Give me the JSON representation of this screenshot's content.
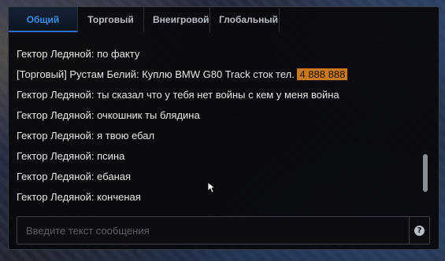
{
  "tabs": [
    {
      "label": "Общий",
      "active": true
    },
    {
      "label": "Торговый",
      "active": false
    },
    {
      "label": "Внеигровой",
      "active": false
    },
    {
      "label": "Глобальный",
      "active": false
    }
  ],
  "messages": [
    {
      "text": "Гектор Ледяной: по факту"
    },
    {
      "text": "[Торговый] Рустам Белий: Куплю BMW G80 Track сток тел.",
      "phone": "4 888 888",
      "phone_color": "#c9781d"
    },
    {
      "text": "Гектор Ледяной: ты сказал что у тебя нет войны с кем у меня война"
    },
    {
      "text": "Гектор Ледяной: очкошник ты блядина"
    },
    {
      "text": "Гектор Ледяной: я твою ебал"
    },
    {
      "text": "Гектор Ледяной: псина"
    },
    {
      "text": "Гектор Ледяной: ебаная"
    },
    {
      "text": "Гектор Ледяной: конченая"
    }
  ],
  "input": {
    "placeholder": "Введите текст сообщения",
    "value": ""
  },
  "help_button": {
    "icon": "question-icon",
    "glyph": "?"
  },
  "colors": {
    "active_tab": "#3b8de6",
    "phone_highlight": "#c9781d",
    "text": "#e6e6e6"
  }
}
